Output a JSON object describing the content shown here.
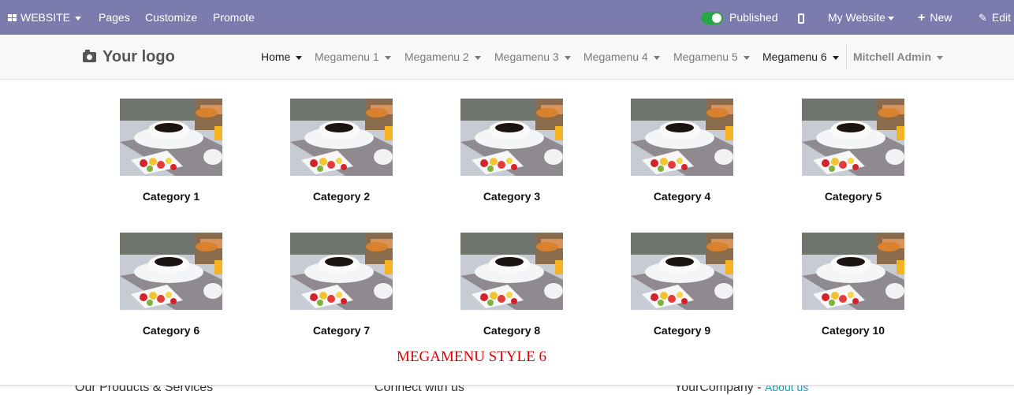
{
  "adminbar": {
    "website_label": "WEBSITE",
    "pages": "Pages",
    "customize": "Customize",
    "promote": "Promote",
    "published": "Published",
    "my_website": "My Website",
    "new": "New",
    "edit": "Edit"
  },
  "navbar": {
    "logo": "Your logo",
    "items": [
      "Home",
      "Megamenu 1",
      "Megamenu 2",
      "Megamenu 3",
      "Megamenu 4",
      "Megamenu 5",
      "Megamenu 6"
    ],
    "user": "Mitchell Admin"
  },
  "megamenu": {
    "categories": [
      "Category 1",
      "Category 2",
      "Category 3",
      "Category 4",
      "Category 5",
      "Category 6",
      "Category 7",
      "Category 8",
      "Category 9",
      "Category 10"
    ],
    "style_title": "MEGAMENU STYLE 6"
  },
  "footer": {
    "col1": "Our Products & Services",
    "col2": "Connect with us",
    "col3": "YourCompany",
    "col3_sep": " - ",
    "col3_link": "About us"
  },
  "colors": {
    "adminbar": "#7c7bad",
    "toggle_on": "#28a745",
    "megamenu_style_title": "#e30000",
    "link": "#17a2b8"
  }
}
